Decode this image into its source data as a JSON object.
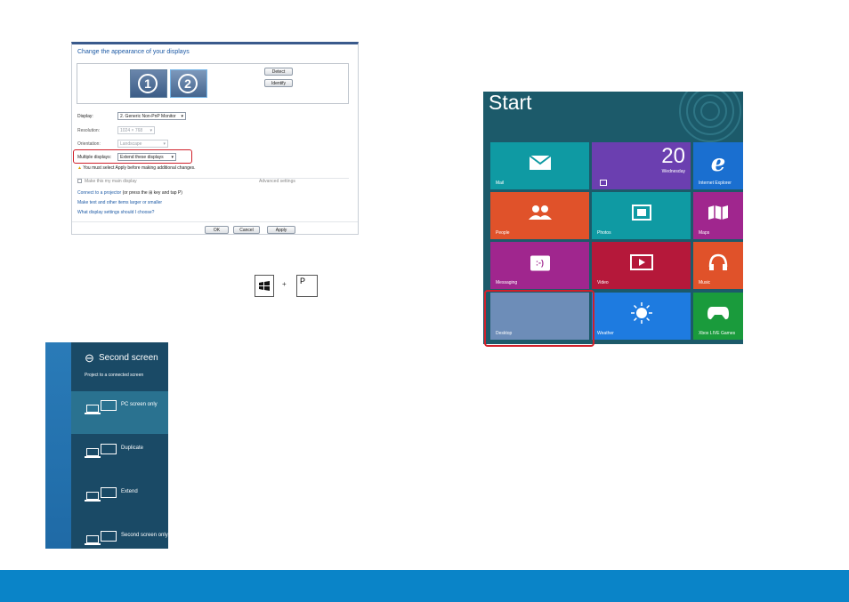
{
  "display_settings": {
    "title": "Change the appearance of your displays",
    "monitors": [
      "1",
      "2"
    ],
    "detect_label": "Detect",
    "identify_label": "Identify",
    "display_label": "Display:",
    "display_value": "2. Generic Non-PnP Monitor",
    "resolution_label": "Resolution:",
    "resolution_value": "1024 × 768",
    "orientation_label": "Orientation:",
    "orientation_value": "Landscape",
    "multiple_label": "Multiple displays:",
    "multiple_value": "Extend these displays",
    "warning": "You must select Apply before making additional changes.",
    "main_display_label": "Make this my main display",
    "advanced_label": "Advanced settings",
    "projector_link": "Connect to a projector",
    "projector_hint": "(or press the",
    "projector_hint2": "key and tap P)",
    "text_link": "Make text and other items larger or smaller",
    "help_link": "What display settings should I choose?",
    "ok_label": "OK",
    "cancel_label": "Cancel",
    "apply_label": "Apply"
  },
  "shortcut": {
    "plus": "+",
    "key": "P"
  },
  "second_screen": {
    "title": "Second screen",
    "subtitle": "Project to a connected screen",
    "options": [
      "PC screen only",
      "Duplicate",
      "Extend",
      "Second screen only"
    ]
  },
  "start": {
    "title": "Start",
    "tiles": {
      "mail": "Mail",
      "calendar_day": "20",
      "calendar_weekday": "Wednesday",
      "ie": "Internet Explorer",
      "people": "People",
      "photos": "Photos",
      "maps": "Maps",
      "messaging": "Messaging",
      "messaging_icon": ":-)",
      "video": "Video",
      "music": "Music",
      "desktop": "Desktop",
      "weather": "Weather",
      "xbox": "Xbox LIVE Games"
    }
  },
  "colors": {
    "accent_red": "#d0202a",
    "footer": "#0a84c8",
    "start_bg": "#1c5a6a"
  }
}
